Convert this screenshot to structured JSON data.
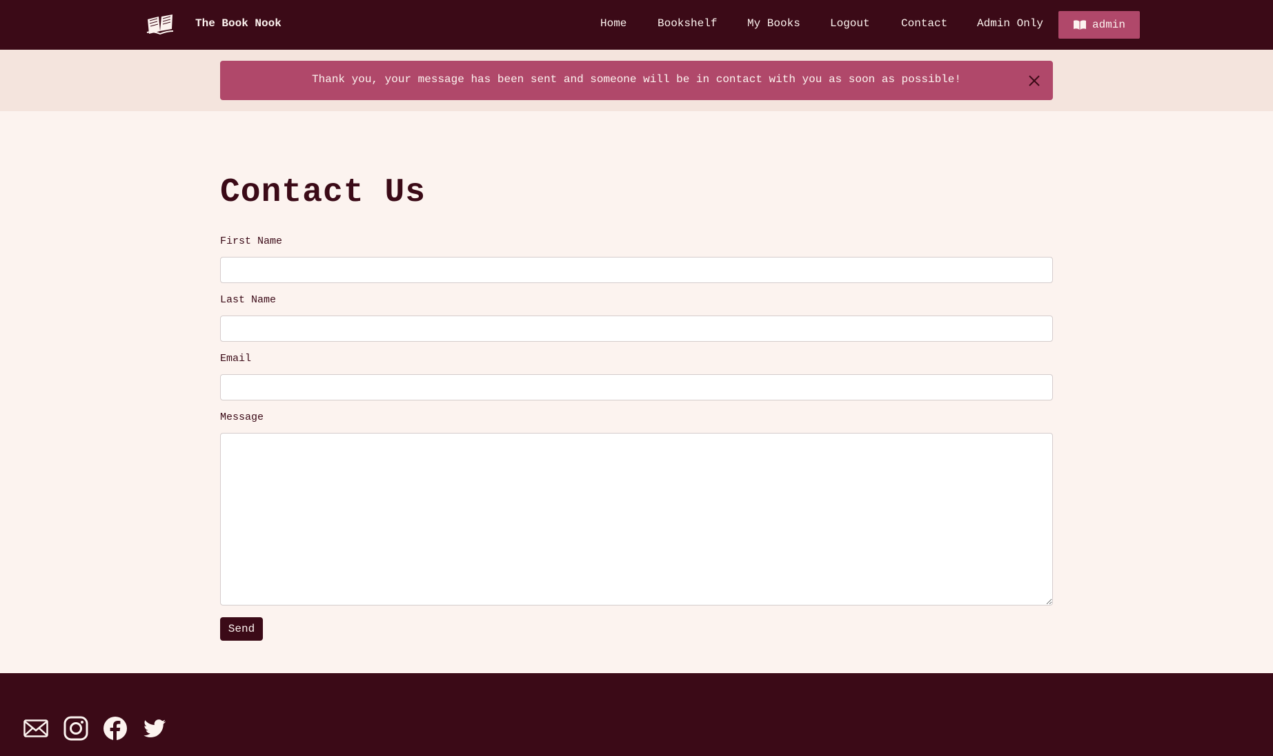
{
  "navbar": {
    "brand": "The Book Nook",
    "links": [
      "Home",
      "Bookshelf",
      "My Books",
      "Logout",
      "Contact",
      "Admin Only"
    ],
    "user_button": "admin",
    "logo_icon": "open-book-icon",
    "user_icon": "book-icon"
  },
  "alert": {
    "message": "Thank you, your message has been sent and someone will be in contact with you as soon as possible!",
    "close_icon": "close-icon"
  },
  "form": {
    "title": "Contact Us",
    "first_name_label": "First Name",
    "first_name_value": "",
    "last_name_label": "Last Name",
    "last_name_value": "",
    "email_label": "Email",
    "email_value": "",
    "message_label": "Message",
    "message_value": "",
    "send_label": "Send"
  },
  "footer": {
    "social_icons": [
      "email-icon",
      "instagram-icon",
      "facebook-icon",
      "twitter-icon"
    ]
  },
  "colors": {
    "primary": "#3b0a17",
    "accent": "#b0486a",
    "background": "#fcf3ef",
    "alert_band": "#f4e4dd"
  }
}
